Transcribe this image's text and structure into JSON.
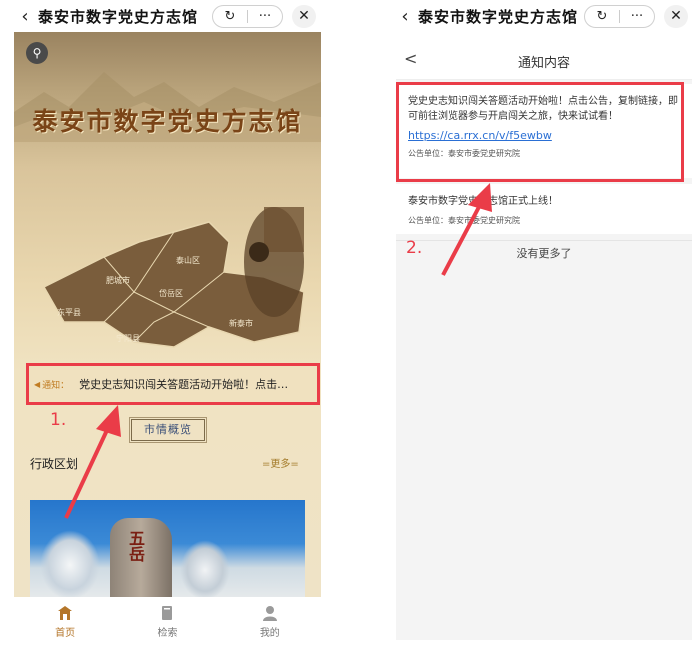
{
  "left": {
    "nav": {
      "back_icon": "‹",
      "title": "泰安市数字党史方志馆",
      "capsule_refresh": "↻",
      "capsule_more": "···",
      "close": "✕"
    },
    "search_icon": "search-icon",
    "main_title": "泰安市数字党史方志馆",
    "map_districts": [
      "泰山区",
      "肥城市",
      "岱岳区",
      "东平县",
      "新泰市",
      "宁阳县"
    ],
    "notice": {
      "label": "通知：",
      "text": "党史史志知识闯关答题活动开始啦！点击…"
    },
    "step_label": "1.",
    "overview_button": "市情概览",
    "section_title": "行政区划",
    "more_link": "更多",
    "tabs": [
      {
        "label": "首页",
        "icon": "home-icon"
      },
      {
        "label": "检索",
        "icon": "book-icon"
      },
      {
        "label": "我的",
        "icon": "user-icon"
      }
    ],
    "accent_color": "#b4762a"
  },
  "right": {
    "nav": {
      "back_icon": "‹",
      "title": "泰安市数字党史方志馆",
      "capsule_refresh": "↻",
      "capsule_more": "···",
      "close": "✕"
    },
    "sub_header": {
      "back_icon": "<",
      "title": "通知内容"
    },
    "notices": [
      {
        "content": "党史史志知识闯关答题活动开始啦！点击公告，复制链接，即可前往浏览器参与开启闯关之旅，快来试试看！",
        "link": "https://ca.rrx.cn/v/f5ewbw",
        "publisher": "公告单位：泰安市委党史研究院"
      },
      {
        "content": "泰安市数字党史方志馆正式上线！",
        "publisher": "公告单位：泰安市委党史研究院"
      }
    ],
    "step_label": "2.",
    "no_more": "没有更多了",
    "link_color": "#2a6fd4"
  },
  "annotation_color": "#ea3c48"
}
